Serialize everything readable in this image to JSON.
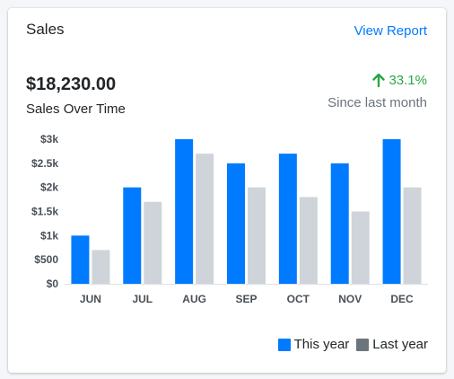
{
  "card": {
    "title": "Sales",
    "view_report_label": "View Report",
    "amount": "$18,230.00",
    "amount_label": "Sales Over Time",
    "change_value": "33.1%",
    "change_label": "Since last month",
    "change_icon": "arrow-up-icon",
    "accent_color": "#007bff",
    "positive_color": "#28a745",
    "muted_color": "#6c757d"
  },
  "chart_data": {
    "type": "bar",
    "categories": [
      "JUN",
      "JUL",
      "AUG",
      "SEP",
      "OCT",
      "NOV",
      "DEC"
    ],
    "series": [
      {
        "name": "This year",
        "color": "#007bff",
        "values": [
          1000,
          2000,
          3000,
          2500,
          2700,
          2500,
          3000
        ]
      },
      {
        "name": "Last year",
        "color": "#ced4da",
        "values": [
          700,
          1700,
          2700,
          2000,
          1800,
          1500,
          2000
        ]
      }
    ],
    "yticks": [
      "$0",
      "$500",
      "$1k",
      "$1.5k",
      "$2k",
      "$2.5k",
      "$3k"
    ],
    "ylim": [
      0,
      3000
    ],
    "grid": false
  },
  "legend": {
    "this_year_label": "This year",
    "last_year_label": "Last year",
    "this_year_color": "#007bff",
    "last_year_color": "#6c757d"
  }
}
